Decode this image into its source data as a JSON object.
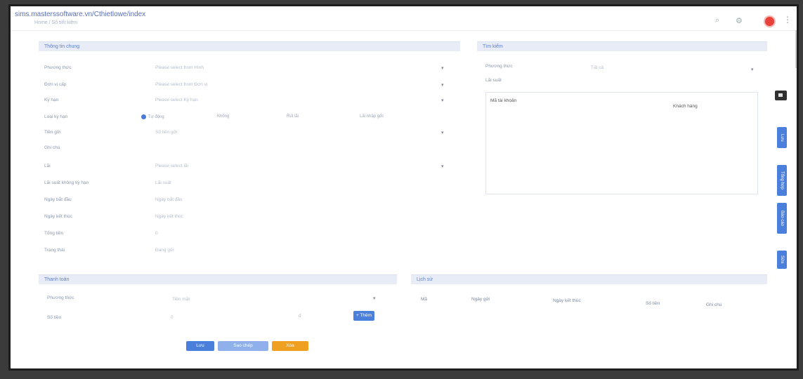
{
  "header": {
    "url": "sims.masterssoftware.vn/Cthietlowe/index",
    "breadcrumb": "Home  /  Sổ tiết kiệm",
    "search_icon": "search-icon",
    "settings_icon": "gear-icon",
    "more_icon": "more-vertical-icon"
  },
  "info_panel": {
    "title": "Thông tin chung",
    "fields": [
      {
        "label": "Phương thức",
        "value": "Please select from Hình"
      },
      {
        "label": "Đơn vị cấp",
        "value": "Please select from Đơn vị"
      },
      {
        "label": "Kỳ hạn",
        "value": "Please select Kỳ hạn"
      },
      {
        "label": "Loại kỳ hạn",
        "value": ""
      },
      {
        "label": "Tiền gửi",
        "value": "Số tiền gửi"
      },
      {
        "label": "Ghi chú",
        "value": ""
      },
      {
        "label": "Lãi",
        "value": "Please select lãi"
      },
      {
        "label": "Lãi suất không kỳ hạn",
        "value": "Lãi suất"
      },
      {
        "label": "Ngày bắt đầu",
        "value": "Ngày bắt đầu"
      },
      {
        "label": "Ngày kết thúc",
        "value": "Ngày kết thúc"
      },
      {
        "label": "Tổng tiền",
        "value": "0"
      },
      {
        "label": "Trạng thái",
        "value": "Đang gửi"
      }
    ],
    "radio_options": [
      "Tự động",
      "Không",
      "Rút lãi",
      "Lãi nhập gốc"
    ]
  },
  "filter_panel": {
    "title": "Tìm kiếm",
    "type_label": "Phương thức",
    "type_value": "Tất cả",
    "sub_label": "Lãi suất",
    "table_headers": [
      "Mã tài khoản",
      "Khách hàng"
    ]
  },
  "bottom_left": {
    "title": "Thanh toán",
    "field1_label": "Phương thức",
    "field1_value": "Tiền mặt",
    "field2_label": "Số tiền",
    "field2_value": "0",
    "unit": "đ",
    "add_label": "+ Thêm"
  },
  "bottom_right": {
    "title": "Lịch sử",
    "headers": [
      "Mã",
      "Ngày gửi",
      "Ngày kết thúc",
      "Số tiền",
      "Ghi chú"
    ]
  },
  "actions": {
    "save": "Lưu",
    "copy": "Sao chép",
    "delete": "Xóa"
  },
  "side_buttons": [
    "Lưu",
    "Tổng hợp",
    "Báo cáo",
    "Sửa"
  ],
  "colors": {
    "primary": "#4a7fdc",
    "warning": "#f0a020",
    "secondary": "#8fb0ea",
    "danger": "#e8413a"
  }
}
